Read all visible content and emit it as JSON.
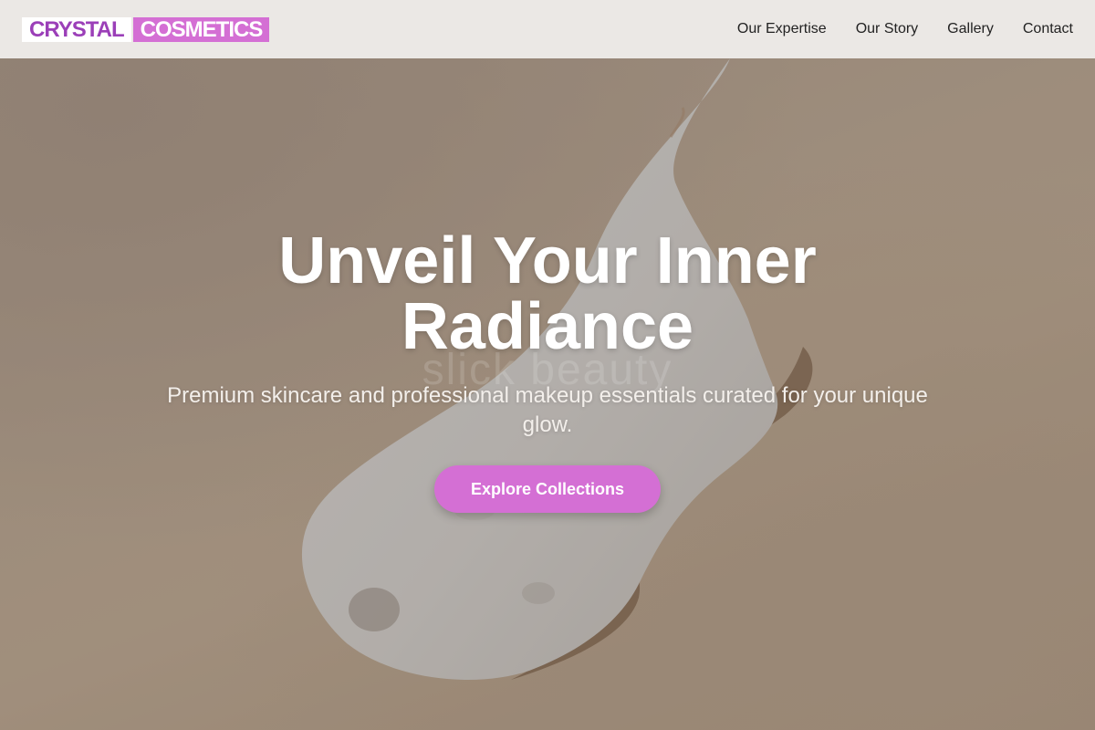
{
  "brand": {
    "name_part1": "CRYSTAL",
    "name_part2": "COSMETICS",
    "accent_color": "#d46fd4",
    "logo_text_color": "#9b3fb8"
  },
  "nav": {
    "items": [
      {
        "label": "Our Expertise"
      },
      {
        "label": "Our Story"
      },
      {
        "label": "Gallery"
      },
      {
        "label": "Contact"
      }
    ]
  },
  "hero": {
    "headline": "Unveil Your Inner Radiance",
    "background_watermark": "slick beauty",
    "subheadline": "Premium skincare and professional makeup essentials curated for your unique glow.",
    "cta_label": "Explore Collections"
  }
}
